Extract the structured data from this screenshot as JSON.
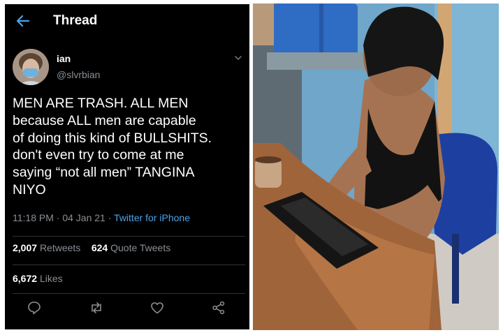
{
  "header": {
    "title": "Thread"
  },
  "user": {
    "display_name": "ian",
    "handle": "@slvrbian"
  },
  "tweet": {
    "text": "MEN ARE TRASH. ALL MEN\nbecause ALL men are capable\nof doing this kind of BULLSHITS.\ndon't even try to come at me\nsaying “not all men” TANGINA\nNIYO",
    "time": "11:18 PM",
    "separator1": " · ",
    "date": "04 Jan 21",
    "separator2": " · ",
    "source": "Twitter for iPhone"
  },
  "stats": {
    "retweets_count": "2,007",
    "retweets_label": "Retweets",
    "quote_count": "624",
    "quote_label": "Quote Tweets",
    "likes_count": "6,672",
    "likes_label": "Likes"
  },
  "actions": [
    "reply-icon",
    "retweet-icon",
    "like-icon",
    "share-icon"
  ],
  "colors": {
    "background": "#000000",
    "accent": "#4aa3e8",
    "muted": "#8a8f94"
  }
}
